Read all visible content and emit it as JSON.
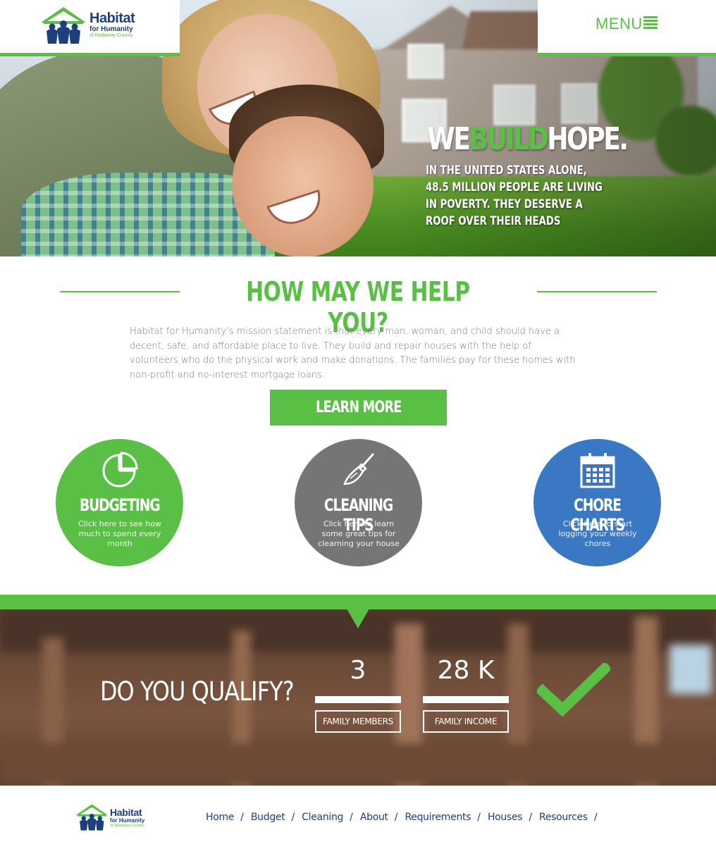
{
  "brand": {
    "line1": "Habitat",
    "line2": "for Humanity",
    "line3": "of Nodaway County",
    "colors": {
      "green": "#5abf45",
      "blue": "#1d3f7c",
      "grey": "#747576",
      "circle_blue": "#3a78c4"
    }
  },
  "header": {
    "menu_label": "MENU",
    "menu_icon": "hamburger-icon"
  },
  "hero": {
    "title_part1": "WE",
    "title_part2": "BUILD",
    "title_part3": "HOPE.",
    "subtitle": "IN THE UNITED STATES ALONE, 48.5 MILLION PEOPLE ARE LIVING IN POVERTY. THEY DESERVE A ROOF OVER THEIR HEADS"
  },
  "help": {
    "title": "HOW MAY WE HELP YOU?",
    "text": "Habitat for Humanity's mission statement is that every man, woman, and child should have a decent, safe, and affordable place to live. They build and repair houses with the help of volunteers who do the physical work and make donations. The families pay for these homes with non-profit and no-interest mortgage loans.",
    "button_label": "LEARN MORE"
  },
  "features": [
    {
      "title": "BUDGETING",
      "description": "Click here to see how much to spend every month",
      "icon": "pie-chart-icon"
    },
    {
      "title": "CLEANING TIPS",
      "description": "Click here to learn some great tips for clearning your house",
      "icon": "broom-icon"
    },
    {
      "title": "CHORE CHARTS",
      "description": "Click here to start logging your weekly chores",
      "icon": "calendar-icon"
    }
  ],
  "qualify": {
    "title": "DO YOU QUALIFY?",
    "family_members_value": "3",
    "family_members_label": "FAMILY MEMBERS",
    "family_income_value": "28 K",
    "family_income_label": "FAMILY INCOME",
    "status_icon": "checkmark-icon"
  },
  "footer": {
    "nav": [
      "Home",
      "Budget",
      "Cleaning",
      "About",
      "Requirements",
      "Houses",
      "Resources"
    ],
    "separator": "/"
  }
}
